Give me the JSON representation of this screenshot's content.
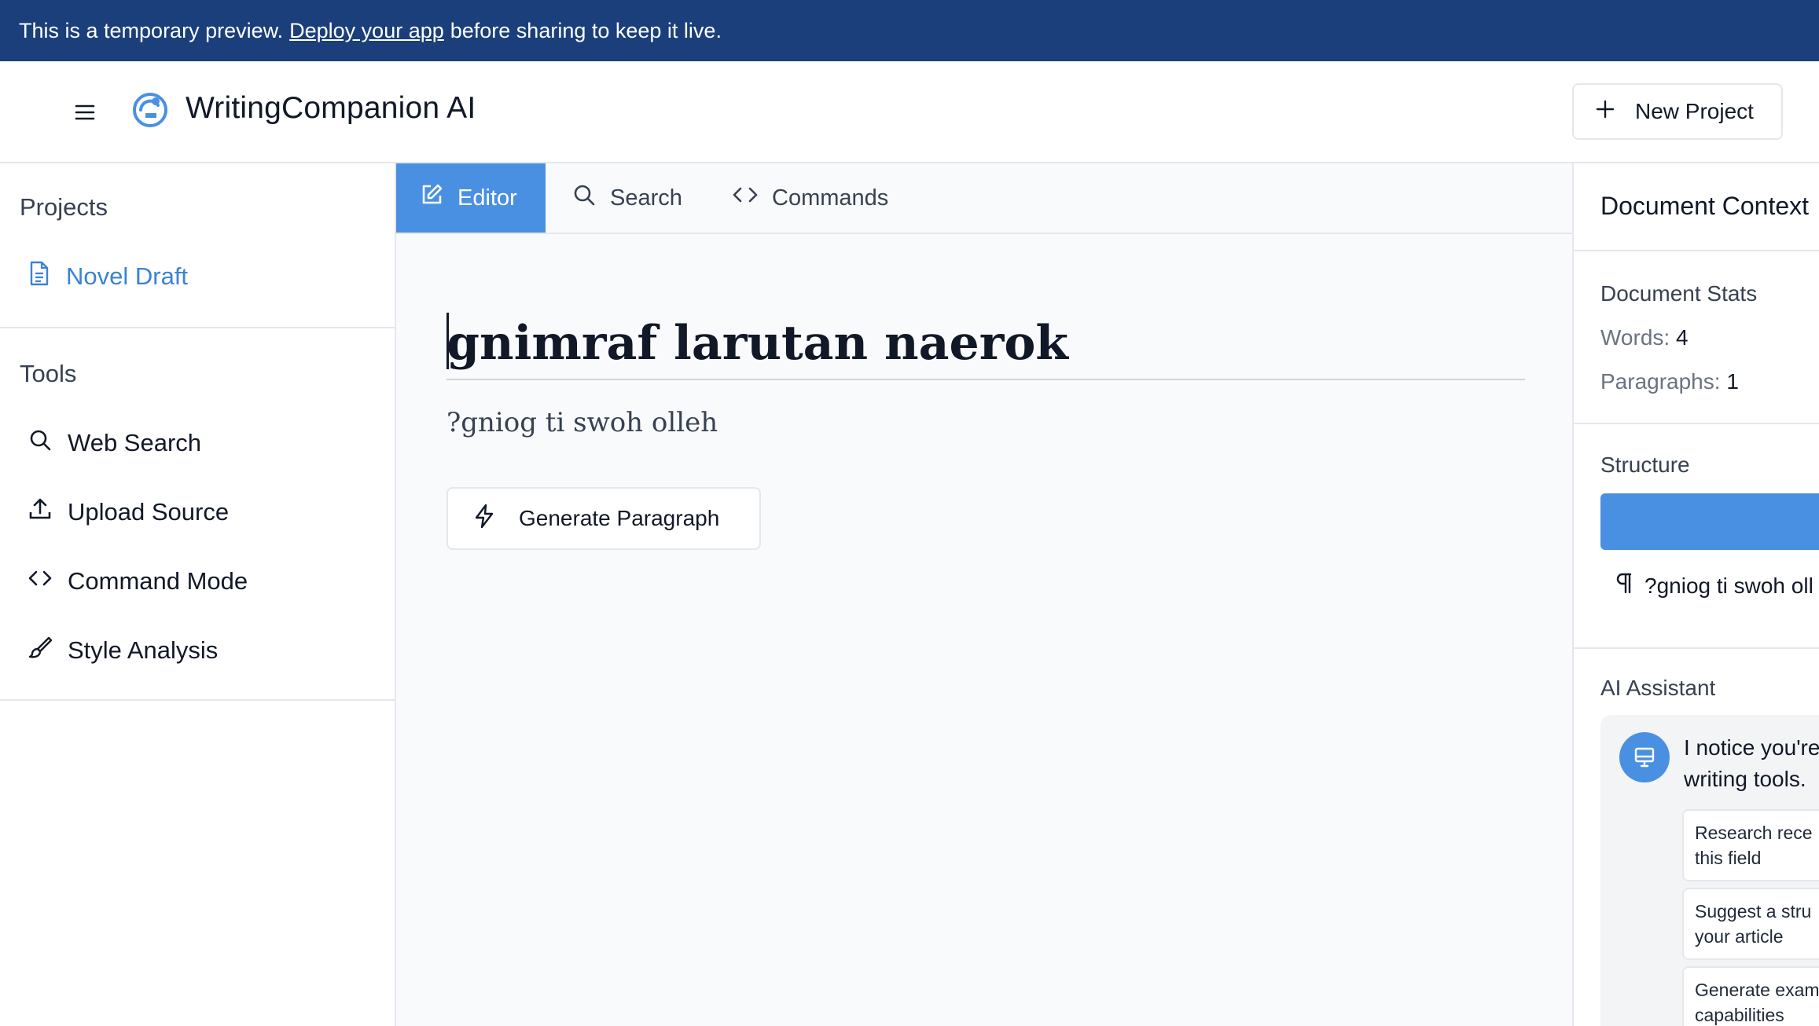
{
  "banner": {
    "text_before": "This is a temporary preview.",
    "link": "Deploy your app",
    "text_after": "before sharing to keep it live."
  },
  "header": {
    "title": "WritingCompanion AI",
    "new_project_label": "New Project"
  },
  "sidebar": {
    "projects_title": "Projects",
    "projects": [
      {
        "label": "Novel Draft",
        "icon": "document-icon"
      }
    ],
    "tools_title": "Tools",
    "tools": [
      {
        "label": "Web Search",
        "icon": "search-icon"
      },
      {
        "label": "Upload Source",
        "icon": "upload-icon"
      },
      {
        "label": "Command Mode",
        "icon": "code-icon"
      },
      {
        "label": "Style Analysis",
        "icon": "brush-icon"
      }
    ]
  },
  "tabs": [
    {
      "label": "Editor",
      "icon": "edit-icon",
      "active": true
    },
    {
      "label": "Search",
      "icon": "search-icon",
      "active": false
    },
    {
      "label": "Commands",
      "icon": "code-icon",
      "active": false
    }
  ],
  "editor": {
    "title": "gnimraf larutan naerok",
    "paragraph": "?gniog ti swoh olleh",
    "generate_label": "Generate Paragraph"
  },
  "context": {
    "title": "Document Context",
    "stats_title": "Document Stats",
    "words_label": "Words:",
    "words_value": "4",
    "paragraphs_label": "Paragraphs:",
    "paragraphs_value": "1",
    "structure_title": "Structure",
    "structure_item": "?gniog ti swoh oll",
    "assistant_title": "AI Assistant",
    "assistant_msg_line1": "I notice you're",
    "assistant_msg_line2": "writing tools.",
    "suggestions": [
      "Research rece\nthis field",
      "Suggest a stru\nyour article",
      "Generate exam\ncapabilities"
    ]
  },
  "colors": {
    "banner": "#1a3f7a",
    "accent": "#4a90e2",
    "active_link": "#3b82d6"
  }
}
